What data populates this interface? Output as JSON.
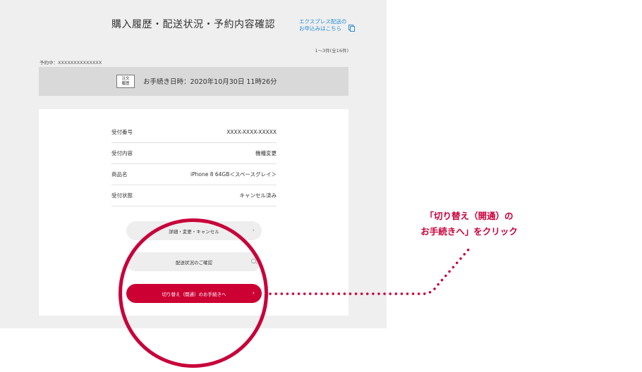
{
  "header": {
    "title": "購入履歴・配送状況・予約内容確認",
    "express_link_line1": "エクスプレス配送の",
    "express_link_line2": "お申込みはこちら"
  },
  "summary": {
    "count": "1〜3件(全16件)",
    "reserve_id": "予約中：XXXXXXXXXXXXXX"
  },
  "order": {
    "badge_line1": "注文",
    "badge_line2": "履歴",
    "datetime": "お手続き日時：2020年10月30日 11時26分"
  },
  "details": [
    {
      "label": "受付番号",
      "value": "XXXX-XXXX-XXXXX"
    },
    {
      "label": "受付内容",
      "value": "機種変更"
    },
    {
      "label": "商品名",
      "value": "iPhone 8 64GB＜スペースグレイ＞"
    },
    {
      "label": "受付状態",
      "value": "キャンセル済み"
    }
  ],
  "buttons": {
    "detail_change_cancel": "詳細・変更・キャンセル",
    "shipping_status": "配送状況のご確認",
    "switch_activation": "切り替え（開通）のお手続きへ"
  },
  "callout": {
    "line1": "「切り替え（開通）の",
    "line2": "お手続きへ」をクリック"
  },
  "colors": {
    "accent": "#cc0033",
    "link": "#2a8fd6",
    "panel_bg": "#efefef"
  }
}
